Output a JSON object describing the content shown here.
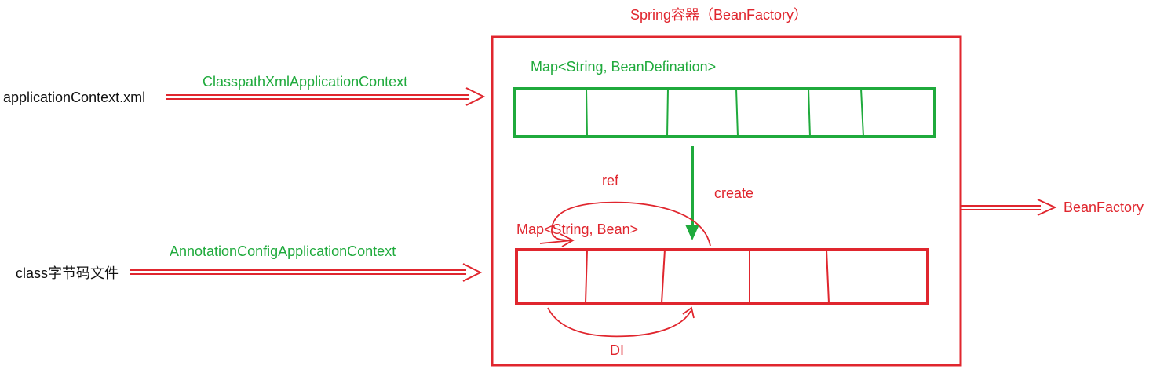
{
  "container_title": "Spring容器（BeanFactory）",
  "bean_definition_map_label": "Map<String, BeanDefination>",
  "bean_map_label": "Map<String, Bean>",
  "create_label": "create",
  "ref_label": "ref",
  "di_label": "DI",
  "inputs": [
    {
      "source": "applicationContext.xml",
      "context": "ClasspathXmlApplicationContext"
    },
    {
      "source": "class字节码文件",
      "context": "AnnotationConfigApplicationContext"
    }
  ],
  "output": "BeanFactory",
  "colors": {
    "red": "#e0262e",
    "green": "#1faa3c",
    "text": "#111111"
  }
}
